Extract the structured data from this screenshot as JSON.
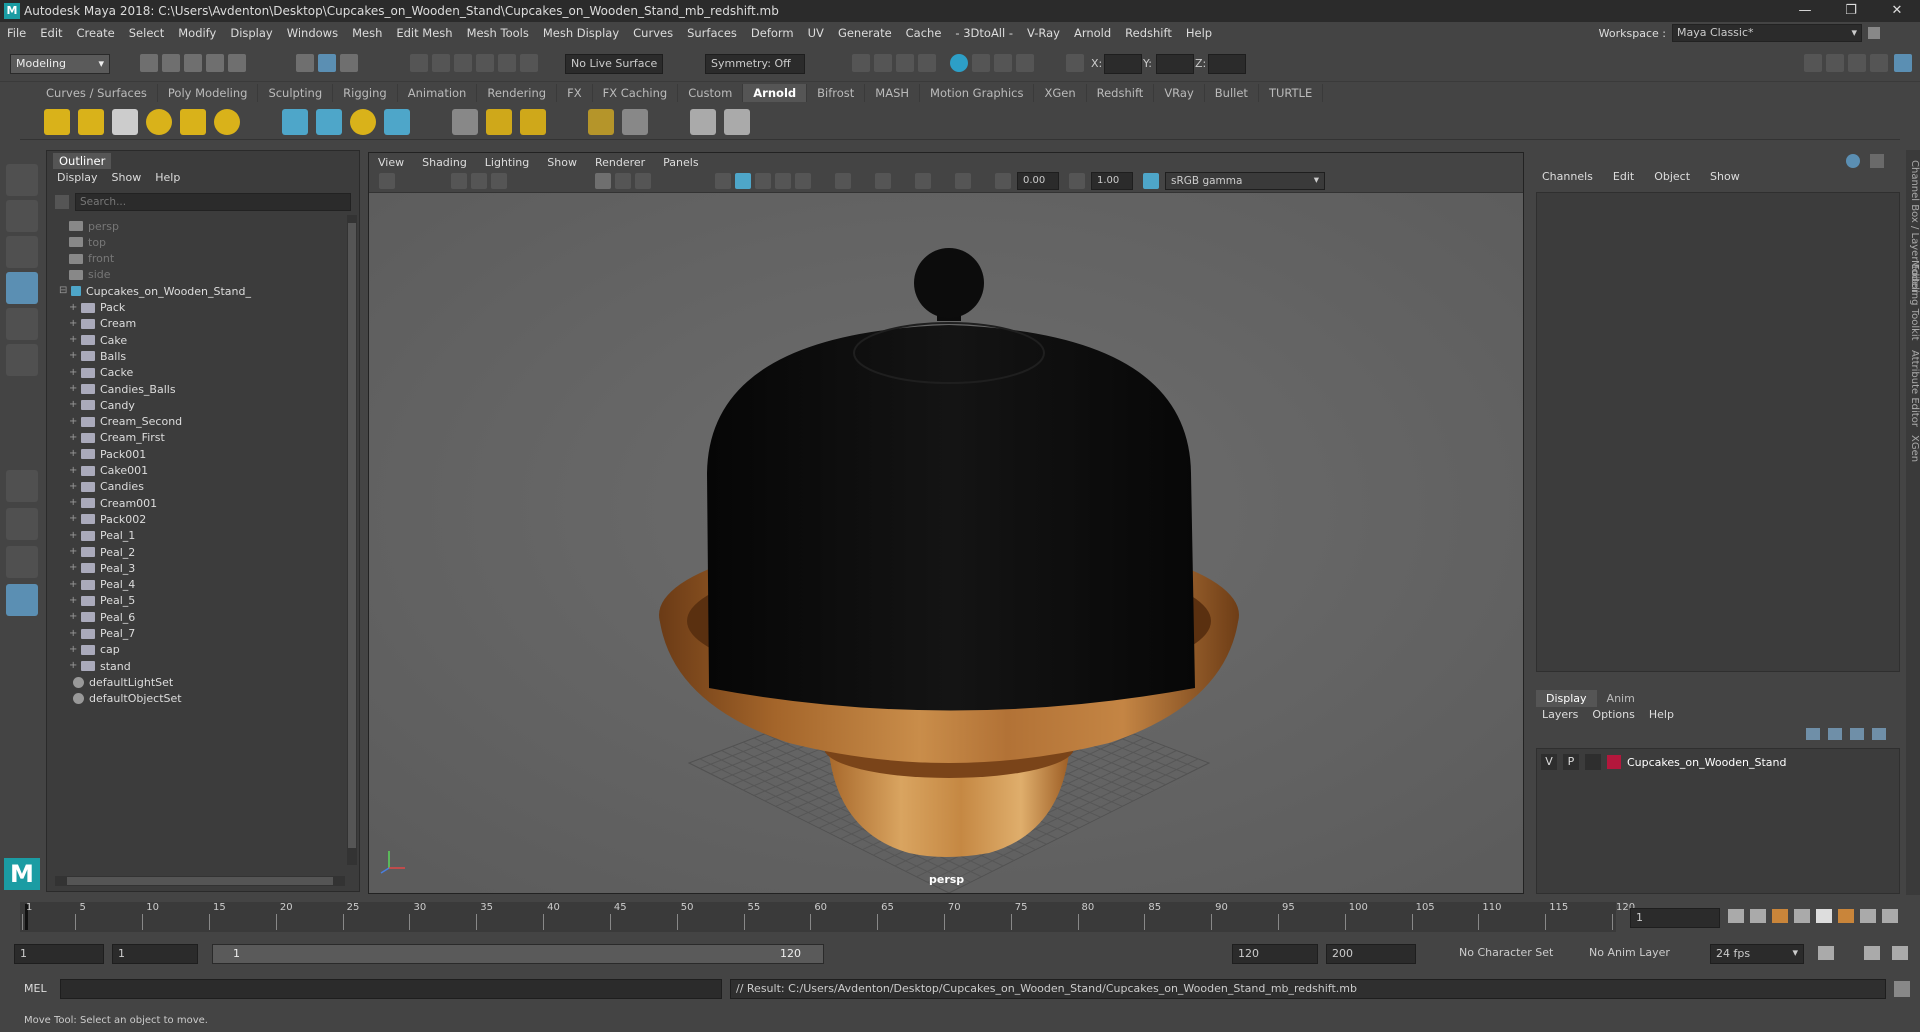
{
  "window": {
    "title": "Autodesk Maya 2018: C:\\Users\\Avdenton\\Desktop\\Cupcakes_on_Wooden_Stand\\Cupcakes_on_Wooden_Stand_mb_redshift.mb",
    "minimize": "—",
    "maximize": "❐",
    "close": "✕"
  },
  "menu": [
    "File",
    "Edit",
    "Create",
    "Select",
    "Modify",
    "Display",
    "Windows",
    "Mesh",
    "Edit Mesh",
    "Mesh Tools",
    "Mesh Display",
    "Curves",
    "Surfaces",
    "Deform",
    "UV",
    "Generate",
    "Cache",
    "- 3DtoAll -",
    "V-Ray",
    "Arnold",
    "Redshift",
    "Help"
  ],
  "workspace": {
    "label": "Workspace :",
    "value": "Maya Classic*"
  },
  "status": {
    "mode": "Modeling",
    "live_surface": "No Live Surface",
    "symmetry": "Symmetry: Off",
    "x_label": "X:",
    "y_label": "Y:",
    "z_label": "Z:"
  },
  "shelf_tabs": [
    "Curves / Surfaces",
    "Poly Modeling",
    "Sculpting",
    "Rigging",
    "Animation",
    "Rendering",
    "FX",
    "FX Caching",
    "Custom",
    "Arnold",
    "Bifrost",
    "MASH",
    "Motion Graphics",
    "XGen",
    "Redshift",
    "VRay",
    "Bullet",
    "TURTLE"
  ],
  "shelf_active": "Arnold",
  "outliner": {
    "title": "Outliner",
    "menu": [
      "Display",
      "Show",
      "Help"
    ],
    "search_placeholder": "Search...",
    "cameras": [
      "persp",
      "top",
      "front",
      "side"
    ],
    "root": "Cupcakes_on_Wooden_Stand_",
    "children": [
      "Pack",
      "Cream",
      "Cake",
      "Balls",
      "Cacke",
      "Candies_Balls",
      "Candy",
      "Cream_Second",
      "Cream_First",
      "Pack001",
      "Cake001",
      "Candies",
      "Cream001",
      "Pack002",
      "Peal_1",
      "Peal_2",
      "Peal_3",
      "Peal_4",
      "Peal_5",
      "Peal_6",
      "Peal_7",
      "cap",
      "stand"
    ],
    "sets": [
      "defaultLightSet",
      "defaultObjectSet"
    ]
  },
  "viewport": {
    "menu": [
      "View",
      "Shading",
      "Lighting",
      "Show",
      "Renderer",
      "Panels"
    ],
    "near": "0.00",
    "far": "1.00",
    "colorspace": "sRGB gamma",
    "camera": "persp"
  },
  "channelbox": {
    "menu": [
      "Channels",
      "Edit",
      "Object",
      "Show"
    ]
  },
  "layers": {
    "tabs": [
      "Display",
      "Anim"
    ],
    "active": "Display",
    "menu": [
      "Layers",
      "Options",
      "Help"
    ],
    "row": {
      "v": "V",
      "p": "P",
      "name": "Cupcakes_on_Wooden_Stand",
      "color": "#b3173c"
    }
  },
  "side_tabs": [
    "Channel Box / Layer Editor",
    "Modeling Toolkit",
    "Attribute Editor",
    "XGen"
  ],
  "timeline": {
    "ticks": [
      "1",
      "5",
      "10",
      "15",
      "20",
      "25",
      "30",
      "35",
      "40",
      "45",
      "50",
      "55",
      "60",
      "65",
      "70",
      "75",
      "80",
      "85",
      "90",
      "95",
      "100",
      "105",
      "110",
      "115",
      "120"
    ],
    "current": "1"
  },
  "range": {
    "start": "1",
    "start2": "1",
    "slider_start": "1",
    "slider_end": "120",
    "end": "120",
    "end2": "200",
    "character_set": "No Character Set",
    "anim_layer": "No Anim Layer",
    "fps": "24 fps"
  },
  "cmd": {
    "lang": "MEL",
    "result": "// Result: C:/Users/Avdenton/Desktop/Cupcakes_on_Wooden_Stand/Cupcakes_on_Wooden_Stand_mb_redshift.mb"
  },
  "help_line": "Move Tool: Select an object to move."
}
